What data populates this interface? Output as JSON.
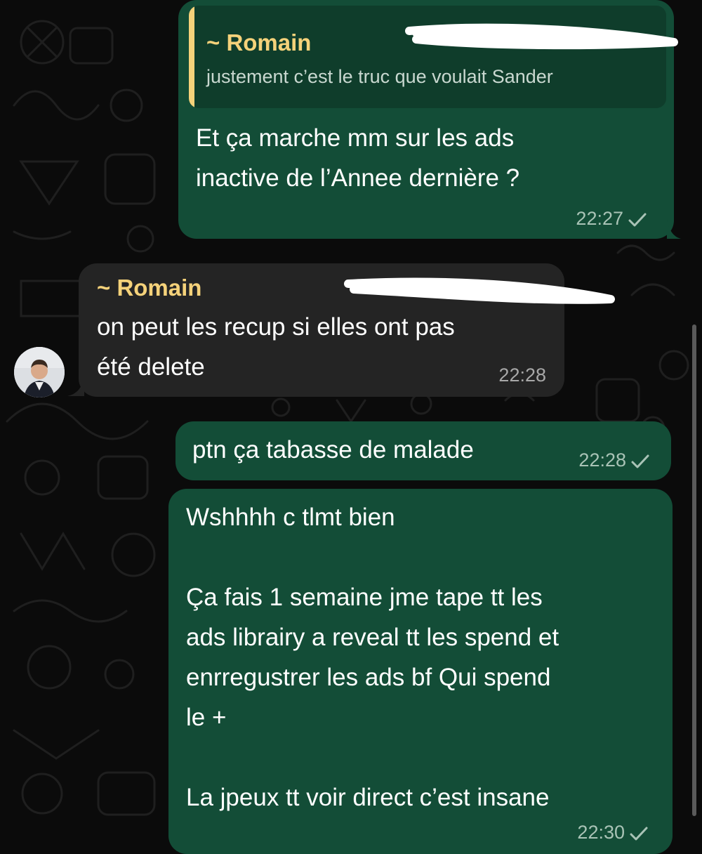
{
  "messages": [
    {
      "direction": "outgoing",
      "quote": {
        "sender": "~ Romain",
        "text": "justement c’est le truc que voulait Sander"
      },
      "text": "Et ça marche mm sur les ads\ninactive de l’Annee dernière ?",
      "time": "22:27",
      "status": "sent-check-icon"
    },
    {
      "direction": "incoming",
      "sender": "~ Romain",
      "text": "on peut les recup si elles ont pas\nété delete",
      "time": "22:28"
    },
    {
      "direction": "outgoing",
      "text": "ptn ça tabasse de malade",
      "time": "22:28",
      "status": "sent-check-icon"
    },
    {
      "direction": "outgoing",
      "text": "Wshhhh c tlmt bien\n\nÇa fais 1 semaine jme tape tt les\nads librairy a reveal tt les spend et\nenrregustrer les ads bf Qui spend\nle +\n\nLa jpeux tt voir direct c’est insane",
      "time": "22:30",
      "status": "sent-check-icon"
    }
  ],
  "colors": {
    "background": "#0b0b0b",
    "outgoing_bubble": "#134d37",
    "incoming_bubble": "#242424",
    "sender_name": "#f5d27a",
    "quote_background": "#0f3d2b"
  }
}
